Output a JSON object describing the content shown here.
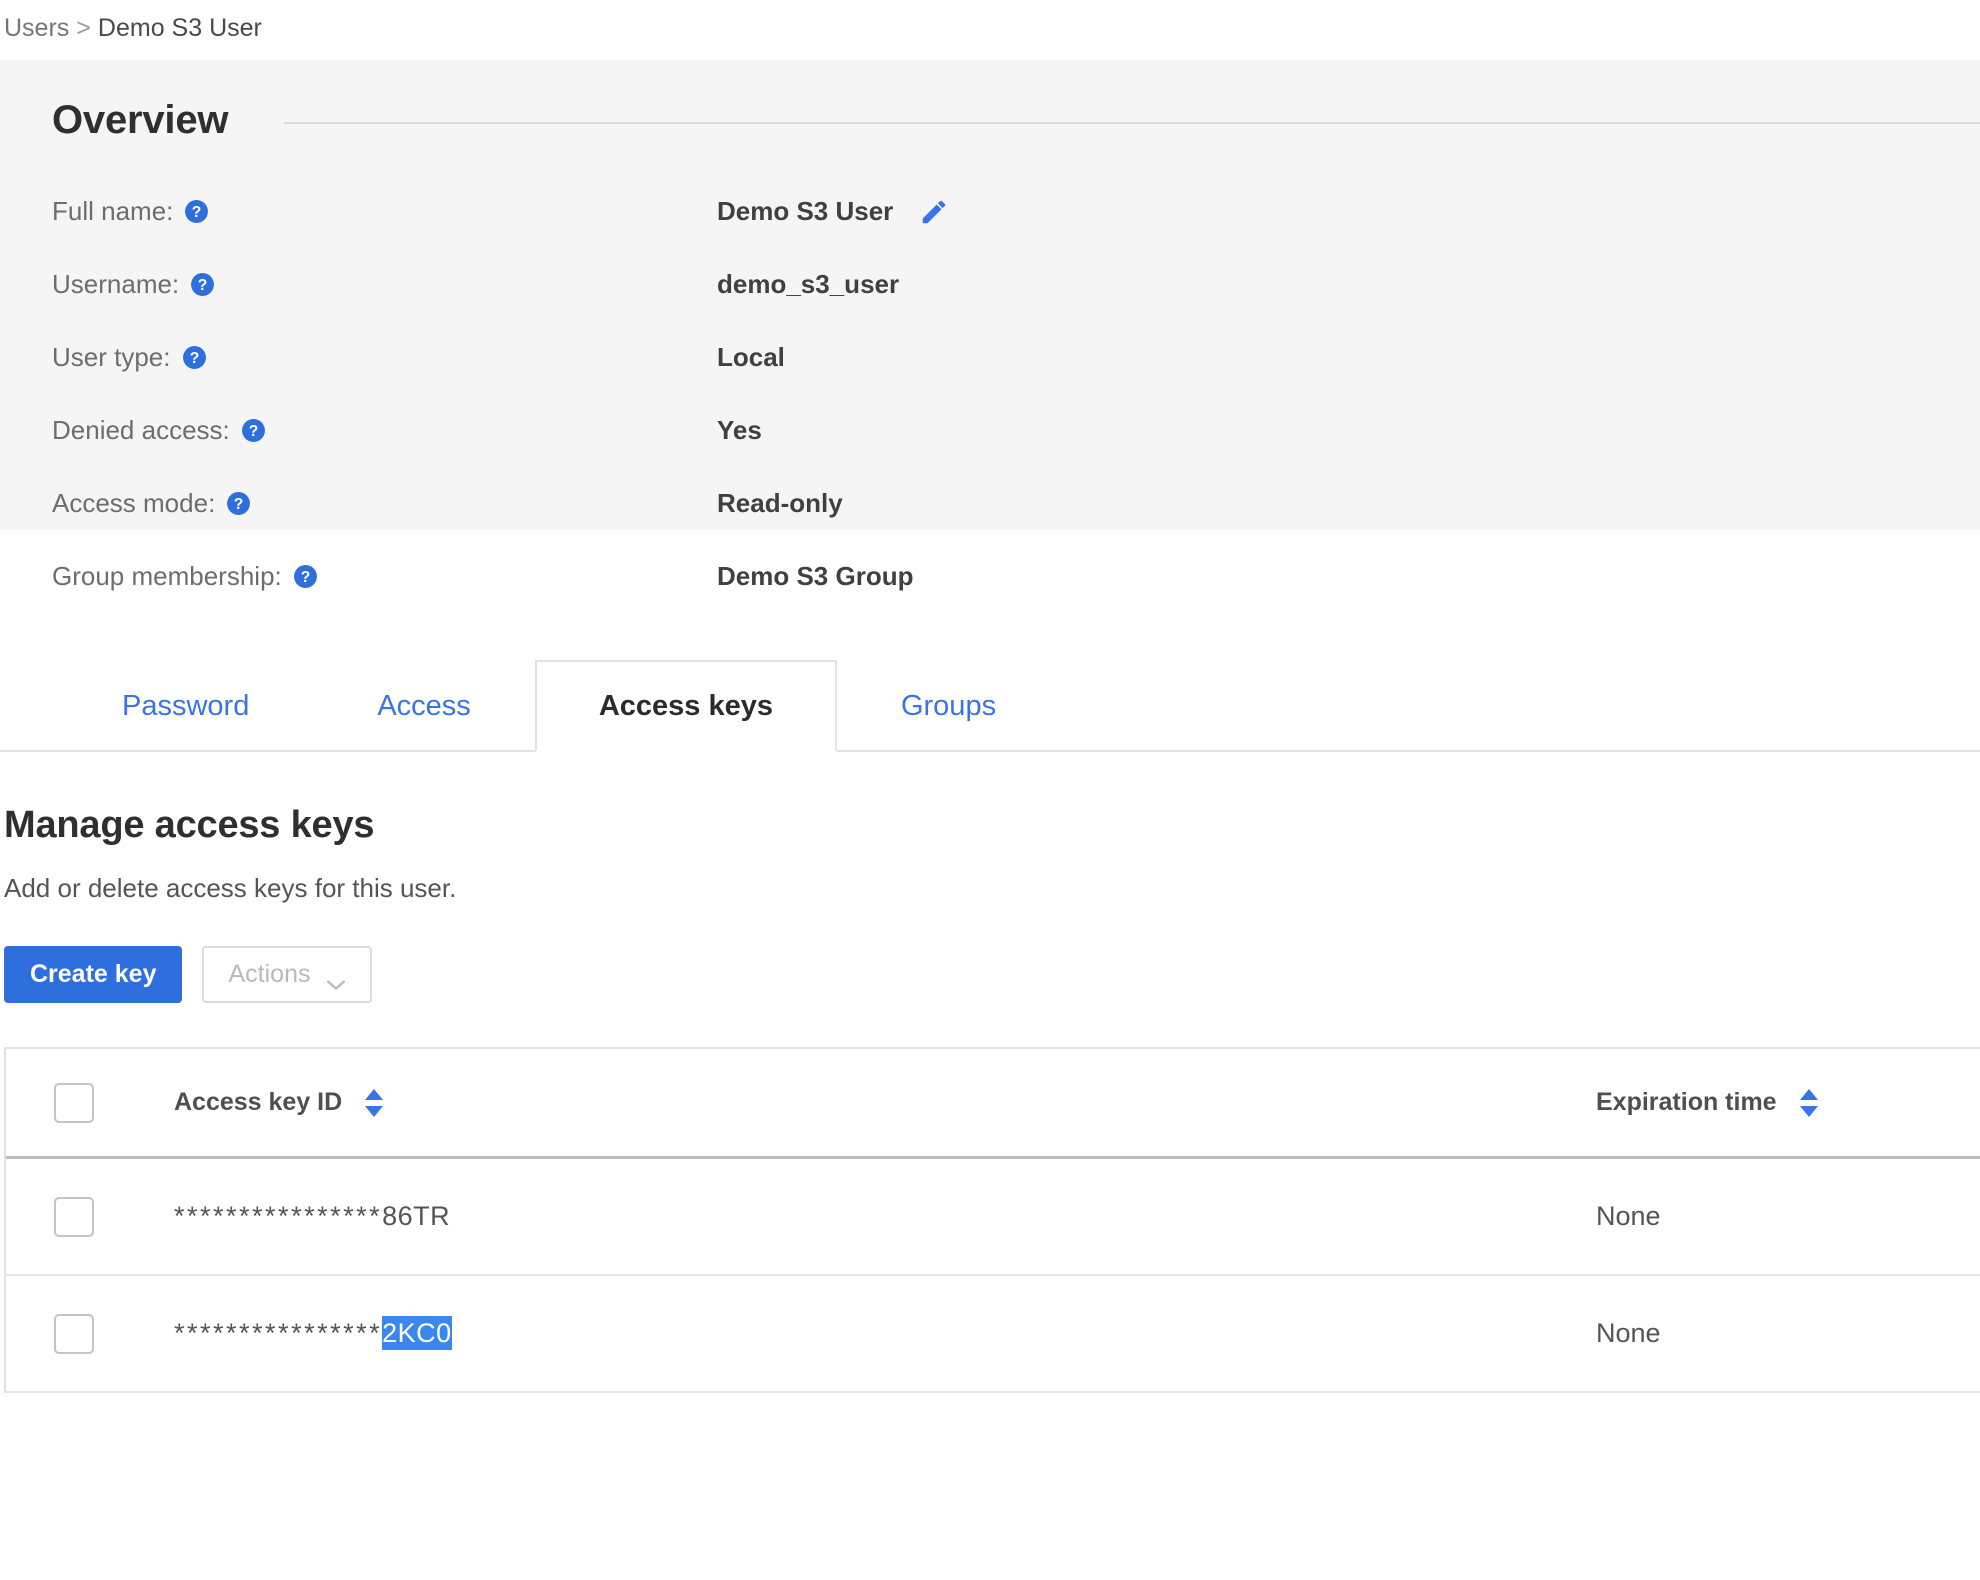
{
  "breadcrumb": {
    "root": "Users",
    "separator": ">",
    "current": "Demo S3 User"
  },
  "overview": {
    "title": "Overview",
    "help_icon": "help-circle-icon",
    "edit_icon": "pencil-icon",
    "fields": [
      {
        "label": "Full name:",
        "value": "Demo S3 User",
        "editable": true
      },
      {
        "label": "Username:",
        "value": "demo_s3_user",
        "editable": false
      },
      {
        "label": "User type:",
        "value": "Local",
        "editable": false
      },
      {
        "label": "Denied access:",
        "value": "Yes",
        "editable": false
      },
      {
        "label": "Access mode:",
        "value": "Read-only",
        "editable": false
      },
      {
        "label": "Group membership:",
        "value": "Demo S3 Group",
        "editable": false
      }
    ]
  },
  "tabs": {
    "items": [
      {
        "label": "Password",
        "active": false
      },
      {
        "label": "Access",
        "active": false
      },
      {
        "label": "Access keys",
        "active": true
      },
      {
        "label": "Groups",
        "active": false
      }
    ]
  },
  "manage": {
    "title": "Manage access keys",
    "subtitle": "Add or delete access keys for this user.",
    "create_button": "Create key",
    "actions_button": "Actions",
    "actions_chevron_icon": "chevron-down-icon",
    "actions_disabled": true
  },
  "table": {
    "select_all_checkbox": "unchecked",
    "columns": [
      {
        "label": "Access key ID",
        "sortable": true,
        "sort_icon": "sort-arrows-icon"
      },
      {
        "label": "Expiration time",
        "sortable": true,
        "sort_icon": "sort-arrows-icon"
      }
    ],
    "rows": [
      {
        "checkbox": "unchecked",
        "key_mask": "****************",
        "key_suffix": "86TR",
        "key_suffix_selected": false,
        "expiration": "None"
      },
      {
        "checkbox": "unchecked",
        "key_mask": "****************",
        "key_suffix": "2KC0",
        "key_suffix_selected": true,
        "expiration": "None"
      }
    ]
  },
  "colors": {
    "accent_blue": "#2f6fdd",
    "link_blue": "#3874e8",
    "selection_blue": "#3b87f0",
    "panel_bg": "#f5f5f5",
    "border_gray": "#e2e2e2"
  }
}
